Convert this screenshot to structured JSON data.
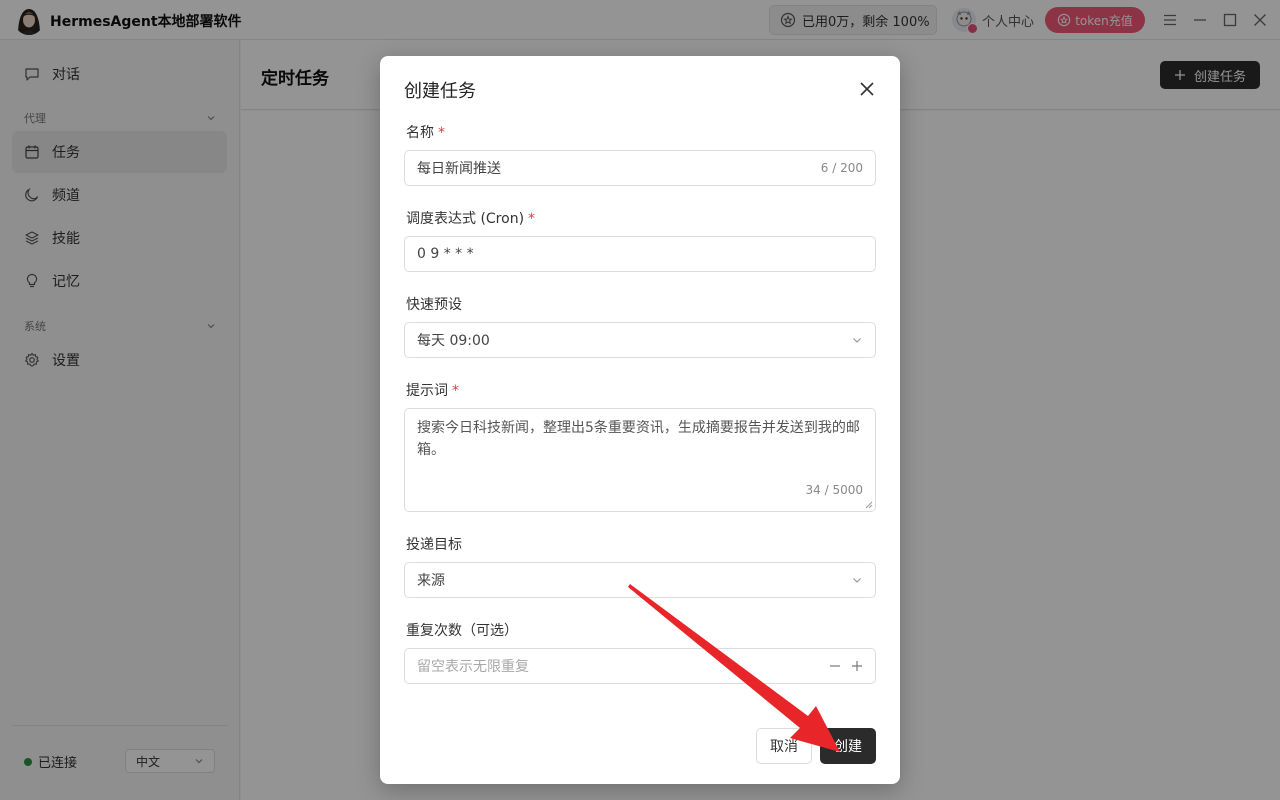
{
  "app": {
    "title": "HermesAgent本地部署软件",
    "usage_text": "已用0万，剩余 100%",
    "profile_label": "个人中心",
    "recharge_label": "token充值"
  },
  "sidebar": {
    "chat_label": "对话",
    "section_agent": "代理",
    "items": [
      {
        "label": "任务",
        "icon": "calendar-icon"
      },
      {
        "label": "频道",
        "icon": "moon-icon"
      },
      {
        "label": "技能",
        "icon": "layers-icon"
      },
      {
        "label": "记忆",
        "icon": "lightbulb-icon"
      }
    ],
    "section_system": "系统",
    "settings_label": "设置",
    "status_text": "已连接",
    "language": "中文"
  },
  "main": {
    "page_title": "定时任务",
    "create_button": "创建任务"
  },
  "modal": {
    "title": "创建任务",
    "name": {
      "label": "名称",
      "value": "每日新闻推送",
      "counter": "6 / 200"
    },
    "cron": {
      "label": "调度表达式 (Cron)",
      "value": "0 9 * * *"
    },
    "preset": {
      "label": "快速预设",
      "value": "每天 09:00"
    },
    "prompt": {
      "label": "提示词",
      "value": "搜索今日科技新闻，整理出5条重要资讯，生成摘要报告并发送到我的邮箱。",
      "counter": "34 / 5000"
    },
    "delivery": {
      "label": "投递目标",
      "value": "来源"
    },
    "repeat": {
      "label": "重复次数（可选）",
      "placeholder": "留空表示无限重复"
    },
    "cancel_label": "取消",
    "submit_label": "创建"
  },
  "colors": {
    "accent_dark": "#2b2b2b",
    "recharge_pink": "#f25a78",
    "required_red": "#e0384f",
    "status_green": "#2f8f45",
    "annotation_arrow": "#e8262a"
  }
}
